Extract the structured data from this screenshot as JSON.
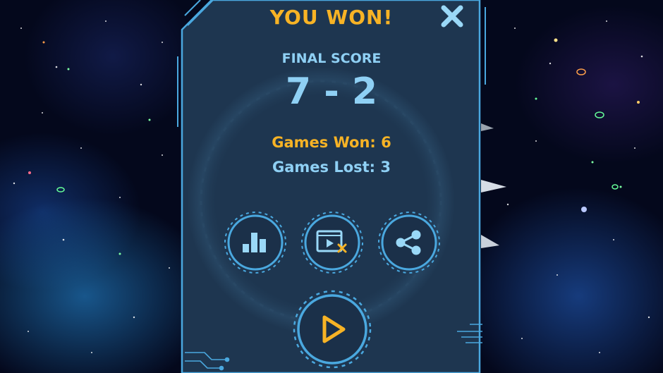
{
  "dialog": {
    "title": "YOU WON!",
    "final_score_label": "FINAL SCORE",
    "score": "7 - 2",
    "games_won": "Games Won: 6",
    "games_lost": "Games Lost: 3"
  },
  "buttons": {
    "close": "close-icon",
    "stats": "bar-chart-icon",
    "video": "video-remove-icon",
    "share": "share-icon",
    "play": "play-icon"
  },
  "colors": {
    "accent_gold": "#f7b325",
    "accent_cyan": "#8fd0f4",
    "panel_fill": "#1e3650",
    "panel_border": "#4aa8df",
    "space_bg": "#04081c"
  }
}
